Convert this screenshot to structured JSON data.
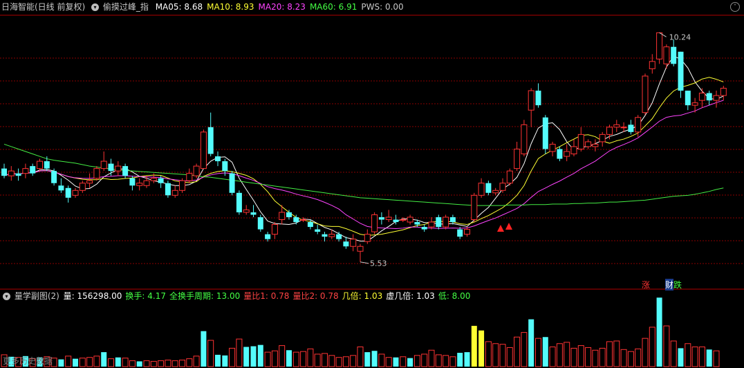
{
  "header": {
    "title": "日海智能(日线 前复权)",
    "indicator_name": "偷摸过峰_指",
    "indicators": [
      {
        "label": "MA05: 8.68",
        "color": "#ffffff"
      },
      {
        "label": "MA10: 8.93",
        "color": "#ffff33"
      },
      {
        "label": "MA20: 8.23",
        "color": "#ff44ff"
      },
      {
        "label": "MA60: 6.91",
        "color": "#44ff44"
      },
      {
        "label": "PWS: 0.00",
        "color": "#c8c8c8"
      }
    ]
  },
  "subchart": {
    "title": "量学副图(2)",
    "items": [
      {
        "label": "量: 156298.00",
        "color": "#ffffff"
      },
      {
        "label": "换手: 4.17",
        "color": "#44ff44"
      },
      {
        "label": "全换手周期: 13.00",
        "color": "#44ff44"
      },
      {
        "label": "量比1: 0.78",
        "color": "#ff4444"
      },
      {
        "label": "量比2: 0.78",
        "color": "#ff4444"
      },
      {
        "label": "几倍: 1.03",
        "color": "#ffff33"
      },
      {
        "label": "虚几倍: 1.03",
        "color": "#ffffff"
      },
      {
        "label": "低: 8.00",
        "color": "#44ff44"
      }
    ],
    "watermark": "更多历史数据"
  },
  "annotations": {
    "high": "10.24",
    "low": "5.53",
    "tag_zhang": "涨",
    "tag_cai": "财",
    "tag_die": "跌"
  },
  "colors": {
    "up": "#ff3333",
    "down": "#54fcfc",
    "ma5": "#ffffff",
    "ma10": "#ffff33",
    "ma20": "#ff44ff",
    "ma60": "#44ee44",
    "grid": "#8b0000"
  },
  "chart_data": {
    "type": "candlestick",
    "price_range": [
      5.0,
      10.6
    ],
    "high_label": 10.24,
    "low_label": 5.53,
    "candles": [
      [
        7.45,
        7.3,
        7.55,
        7.25
      ],
      [
        7.3,
        7.4,
        7.5,
        7.2
      ],
      [
        7.35,
        7.3,
        7.45,
        7.2
      ],
      [
        7.35,
        7.45,
        7.55,
        7.25
      ],
      [
        7.5,
        7.35,
        7.55,
        7.3
      ],
      [
        7.45,
        7.6,
        7.65,
        7.4
      ],
      [
        7.6,
        7.45,
        7.7,
        7.4
      ],
      [
        7.4,
        7.15,
        7.45,
        7.1
      ],
      [
        7.1,
        7.0,
        7.25,
        6.95
      ],
      [
        7.05,
        6.85,
        7.1,
        6.75
      ],
      [
        6.9,
        7.0,
        7.05,
        6.85
      ],
      [
        7.0,
        7.15,
        7.2,
        6.95
      ],
      [
        7.15,
        7.2,
        7.35,
        7.05
      ],
      [
        7.25,
        7.45,
        7.5,
        7.2
      ],
      [
        7.45,
        7.6,
        7.8,
        7.4
      ],
      [
        7.55,
        7.4,
        7.65,
        7.3
      ],
      [
        7.4,
        7.5,
        7.6,
        7.3
      ],
      [
        7.5,
        7.3,
        7.55,
        7.25
      ],
      [
        7.25,
        7.1,
        7.3,
        7.0
      ],
      [
        7.1,
        7.15,
        7.25,
        7.0
      ],
      [
        7.1,
        7.2,
        7.3,
        7.05
      ],
      [
        7.2,
        7.25,
        7.35,
        7.15
      ],
      [
        7.25,
        7.15,
        7.3,
        7.05
      ],
      [
        7.15,
        6.9,
        7.2,
        6.85
      ],
      [
        6.9,
        7.0,
        7.1,
        6.85
      ],
      [
        7.0,
        7.2,
        7.25,
        6.95
      ],
      [
        7.2,
        7.35,
        7.45,
        7.15
      ],
      [
        7.3,
        7.5,
        7.55,
        7.25
      ],
      [
        7.45,
        8.2,
        8.25,
        7.45
      ],
      [
        8.3,
        7.75,
        8.6,
        7.7
      ],
      [
        7.7,
        7.6,
        7.8,
        7.5
      ],
      [
        7.6,
        7.4,
        7.65,
        7.3
      ],
      [
        7.35,
        6.95,
        7.4,
        6.9
      ],
      [
        6.95,
        6.55,
        7.0,
        6.5
      ],
      [
        6.55,
        6.6,
        6.7,
        6.5
      ],
      [
        6.55,
        6.5,
        6.7,
        6.45
      ],
      [
        6.45,
        6.2,
        6.5,
        6.15
      ],
      [
        6.1,
        6.0,
        6.15,
        5.95
      ],
      [
        6.1,
        6.3,
        6.35,
        6.0
      ],
      [
        6.4,
        6.55,
        6.7,
        6.3
      ],
      [
        6.55,
        6.45,
        6.6,
        6.4
      ],
      [
        6.45,
        6.35,
        6.5,
        6.3
      ],
      [
        6.4,
        6.4,
        6.45,
        6.35
      ],
      [
        6.35,
        6.25,
        6.4,
        6.2
      ],
      [
        6.2,
        6.15,
        6.3,
        6.1
      ],
      [
        6.1,
        6.05,
        6.15,
        5.95
      ],
      [
        6.05,
        6.1,
        6.2,
        6.0
      ],
      [
        6.1,
        6.0,
        6.15,
        5.95
      ],
      [
        5.95,
        5.85,
        6.05,
        5.8
      ],
      [
        5.85,
        6.0,
        6.1,
        5.75
      ],
      [
        5.75,
        5.85,
        5.9,
        5.53
      ],
      [
        5.95,
        6.1,
        6.2,
        5.9
      ],
      [
        6.15,
        6.5,
        6.55,
        6.1
      ],
      [
        6.45,
        6.4,
        6.55,
        6.3
      ],
      [
        6.4,
        6.45,
        6.6,
        6.35
      ],
      [
        6.4,
        6.35,
        6.5,
        6.3
      ],
      [
        6.4,
        6.4,
        6.45,
        6.35
      ],
      [
        6.35,
        6.45,
        6.5,
        6.3
      ],
      [
        6.35,
        6.3,
        6.4,
        6.25
      ],
      [
        6.25,
        6.2,
        6.3,
        6.15
      ],
      [
        6.25,
        6.35,
        6.45,
        6.2
      ],
      [
        6.45,
        6.25,
        6.5,
        6.2
      ],
      [
        6.25,
        6.45,
        6.5,
        6.2
      ],
      [
        6.45,
        6.35,
        6.5,
        6.3
      ],
      [
        6.2,
        6.05,
        6.25,
        6.0
      ],
      [
        6.1,
        6.2,
        6.25,
        6.05
      ],
      [
        6.4,
        6.9,
        6.95,
        6.35
      ],
      [
        6.9,
        7.15,
        7.25,
        6.85
      ],
      [
        7.15,
        6.95,
        7.2,
        6.9
      ],
      [
        6.95,
        7.0,
        7.05,
        6.9
      ],
      [
        7.0,
        7.15,
        7.25,
        6.95
      ],
      [
        7.15,
        7.4,
        7.45,
        7.1
      ],
      [
        7.45,
        7.85,
        8.0,
        7.4
      ],
      [
        7.75,
        8.35,
        8.45,
        7.7
      ],
      [
        8.65,
        9.05,
        9.1,
        8.3
      ],
      [
        9.05,
        8.75,
        9.2,
        8.7
      ],
      [
        8.5,
        7.85,
        8.55,
        7.75
      ],
      [
        7.8,
        7.95,
        8.0,
        7.7
      ],
      [
        7.85,
        7.65,
        7.9,
        7.6
      ],
      [
        7.7,
        7.8,
        7.95,
        7.6
      ],
      [
        7.75,
        7.9,
        8.05,
        7.7
      ],
      [
        7.85,
        8.15,
        8.3,
        7.8
      ],
      [
        7.9,
        8.0,
        8.05,
        7.85
      ],
      [
        7.9,
        7.95,
        8.05,
        7.8
      ],
      [
        8.0,
        8.15,
        8.2,
        7.9
      ],
      [
        8.15,
        8.3,
        8.35,
        8.05
      ],
      [
        8.3,
        8.35,
        8.45,
        8.2
      ],
      [
        8.3,
        8.3,
        8.4,
        8.2
      ],
      [
        8.35,
        8.2,
        8.45,
        8.15
      ],
      [
        8.2,
        8.5,
        8.55,
        8.1
      ],
      [
        8.6,
        9.35,
        9.4,
        8.55
      ],
      [
        9.5,
        9.65,
        9.8,
        9.4
      ],
      [
        9.7,
        10.24,
        10.24,
        9.6
      ],
      [
        9.6,
        9.95,
        10.0,
        9.5
      ],
      [
        9.95,
        9.6,
        10.1,
        9.55
      ],
      [
        9.85,
        9.05,
        9.85,
        8.9
      ],
      [
        9.05,
        8.75,
        9.05,
        8.65
      ],
      [
        8.75,
        8.8,
        8.9,
        8.6
      ],
      [
        8.85,
        9.0,
        9.1,
        8.7
      ],
      [
        9.0,
        8.85,
        9.05,
        8.75
      ],
      [
        8.85,
        8.95,
        9.05,
        8.7
      ],
      [
        8.95,
        9.1,
        9.15,
        8.85
      ]
    ],
    "volume": [
      [
        18,
        1
      ],
      [
        15,
        0
      ],
      [
        14,
        1
      ],
      [
        16,
        0
      ],
      [
        12,
        1
      ],
      [
        14,
        0
      ],
      [
        15,
        1
      ],
      [
        13,
        1
      ],
      [
        11,
        0
      ],
      [
        16,
        1
      ],
      [
        12,
        0
      ],
      [
        13,
        1
      ],
      [
        14,
        1
      ],
      [
        16,
        1
      ],
      [
        22,
        0
      ],
      [
        12,
        1
      ],
      [
        14,
        0
      ],
      [
        13,
        1
      ],
      [
        9,
        1
      ],
      [
        8,
        0
      ],
      [
        9,
        1
      ],
      [
        8,
        1
      ],
      [
        9,
        1
      ],
      [
        10,
        1
      ],
      [
        9,
        1
      ],
      [
        10,
        1
      ],
      [
        12,
        1
      ],
      [
        16,
        1
      ],
      [
        54,
        0
      ],
      [
        40,
        1
      ],
      [
        18,
        0
      ],
      [
        17,
        0
      ],
      [
        28,
        1
      ],
      [
        42,
        1
      ],
      [
        30,
        0
      ],
      [
        31,
        0
      ],
      [
        33,
        0
      ],
      [
        22,
        1
      ],
      [
        24,
        1
      ],
      [
        32,
        1
      ],
      [
        25,
        0
      ],
      [
        22,
        1
      ],
      [
        23,
        1
      ],
      [
        27,
        1
      ],
      [
        19,
        1
      ],
      [
        20,
        1
      ],
      [
        17,
        1
      ],
      [
        14,
        1
      ],
      [
        15,
        1
      ],
      [
        17,
        1
      ],
      [
        30,
        1
      ],
      [
        22,
        0
      ],
      [
        24,
        0
      ],
      [
        19,
        1
      ],
      [
        14,
        1
      ],
      [
        14,
        0
      ],
      [
        15,
        1
      ],
      [
        13,
        0
      ],
      [
        17,
        1
      ],
      [
        19,
        1
      ],
      [
        25,
        1
      ],
      [
        18,
        1
      ],
      [
        17,
        1
      ],
      [
        15,
        1
      ],
      [
        21,
        0
      ],
      [
        22,
        0
      ],
      [
        62,
        0
      ],
      [
        55,
        0
      ],
      [
        38,
        1
      ],
      [
        35,
        1
      ],
      [
        34,
        1
      ],
      [
        29,
        1
      ],
      [
        45,
        1
      ],
      [
        52,
        1
      ],
      [
        72,
        0
      ],
      [
        43,
        1
      ],
      [
        45,
        0
      ],
      [
        30,
        1
      ],
      [
        35,
        1
      ],
      [
        37,
        1
      ],
      [
        28,
        1
      ],
      [
        32,
        1
      ],
      [
        29,
        1
      ],
      [
        25,
        1
      ],
      [
        28,
        1
      ],
      [
        38,
        1
      ],
      [
        39,
        1
      ],
      [
        26,
        1
      ],
      [
        23,
        1
      ],
      [
        27,
        1
      ],
      [
        43,
        1
      ],
      [
        60,
        1
      ],
      [
        105,
        0
      ],
      [
        62,
        1
      ],
      [
        39,
        1
      ],
      [
        28,
        0
      ],
      [
        35,
        1
      ],
      [
        30,
        1
      ],
      [
        30,
        1
      ],
      [
        26,
        0
      ],
      [
        24,
        1
      ]
    ]
  }
}
